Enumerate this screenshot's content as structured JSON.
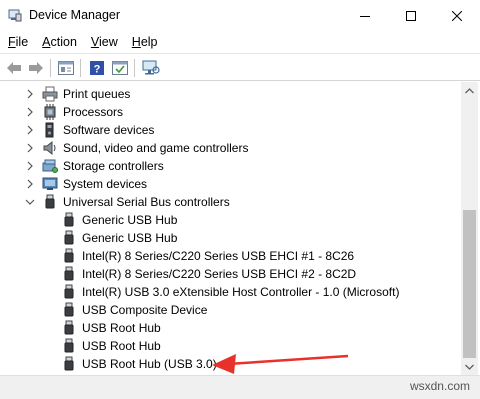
{
  "window": {
    "title": "Device Manager",
    "minimize_glyph": "—",
    "maximize_glyph": "☐",
    "close_glyph": "✕"
  },
  "menu": {
    "items": [
      {
        "label": "File",
        "mnemonic": "F",
        "rest": "ile"
      },
      {
        "label": "Action",
        "mnemonic": "A",
        "rest": "ction"
      },
      {
        "label": "View",
        "mnemonic": "V",
        "rest": "iew"
      },
      {
        "label": "Help",
        "mnemonic": "H",
        "rest": "elp"
      }
    ]
  },
  "toolbar": {
    "buttons": [
      "back-arrow-icon",
      "forward-arrow-icon",
      "properties-icon",
      "help-icon",
      "update-driver-icon",
      "monitor-icon"
    ]
  },
  "tree": {
    "categories": [
      {
        "label": "Print queues",
        "icon": "printer-icon",
        "expanded": false
      },
      {
        "label": "Processors",
        "icon": "processor-icon",
        "expanded": false
      },
      {
        "label": "Software devices",
        "icon": "software-device-icon",
        "expanded": false
      },
      {
        "label": "Sound, video and game controllers",
        "icon": "speaker-icon",
        "expanded": false
      },
      {
        "label": "Storage controllers",
        "icon": "storage-icon",
        "expanded": false
      },
      {
        "label": "System devices",
        "icon": "system-device-icon",
        "expanded": false
      },
      {
        "label": "Universal Serial Bus controllers",
        "icon": "usb-icon",
        "expanded": true
      }
    ],
    "usb_children": [
      "Generic USB Hub",
      "Generic USB Hub",
      "Intel(R) 8 Series/C220 Series  USB EHCI #1 - 8C26",
      "Intel(R) 8 Series/C220 Series  USB EHCI #2 - 8C2D",
      "Intel(R) USB 3.0 eXtensible Host Controller - 1.0 (Microsoft)",
      "USB Composite Device",
      "USB Root Hub",
      "USB Root Hub",
      "USB Root Hub (USB 3.0)"
    ]
  },
  "annotation": {
    "arrow_color": "#e8312a",
    "target_item": "USB Root Hub (USB 3.0)"
  },
  "watermark": "wsxdn.com"
}
